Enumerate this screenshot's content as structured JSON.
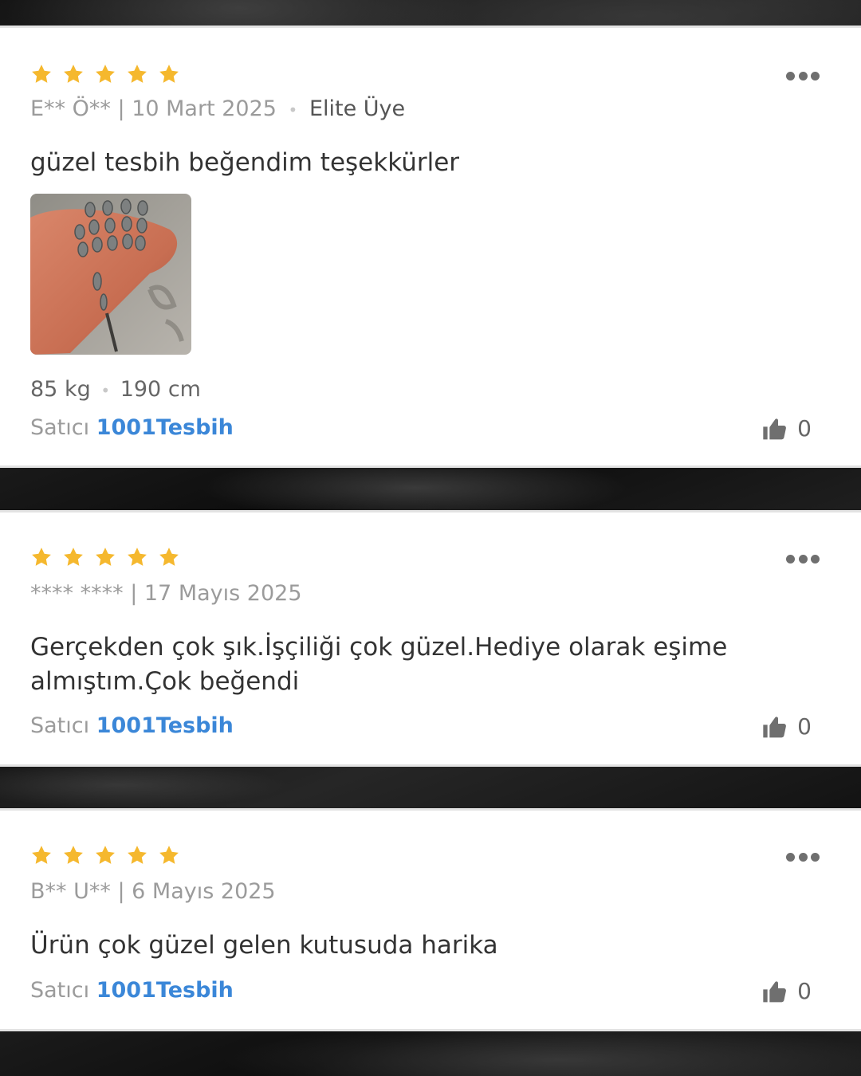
{
  "colors": {
    "star": "#f5b82e",
    "seller_link": "#3b87d8",
    "text": "#333333",
    "muted": "#9b9b9b"
  },
  "reviews": [
    {
      "rating": 5,
      "author": "E** Ö**",
      "date": "10 Mart 2025",
      "badge": "Elite Üye",
      "text": "güzel tesbih beğendim teşekkürler",
      "photo_icon": "tesbih-photo",
      "weight": "85 kg",
      "height": "190 cm",
      "seller_label": "Satıcı",
      "seller_name": "1001Tesbih",
      "likes": "0"
    },
    {
      "rating": 5,
      "author": "**** ****",
      "date": "17 Mayıs 2025",
      "text": "Gerçekden çok şık.İşçiliği çok güzel.Hediye olarak eşime almıştım.Çok beğendi",
      "seller_label": "Satıcı",
      "seller_name": "1001Tesbih",
      "likes": "0"
    },
    {
      "rating": 5,
      "author": "B** U**",
      "date": "6 Mayıs 2025",
      "text": "Ürün çok güzel gelen kutusuda harika",
      "seller_label": "Satıcı",
      "seller_name": "1001Tesbih",
      "likes": "0"
    }
  ]
}
